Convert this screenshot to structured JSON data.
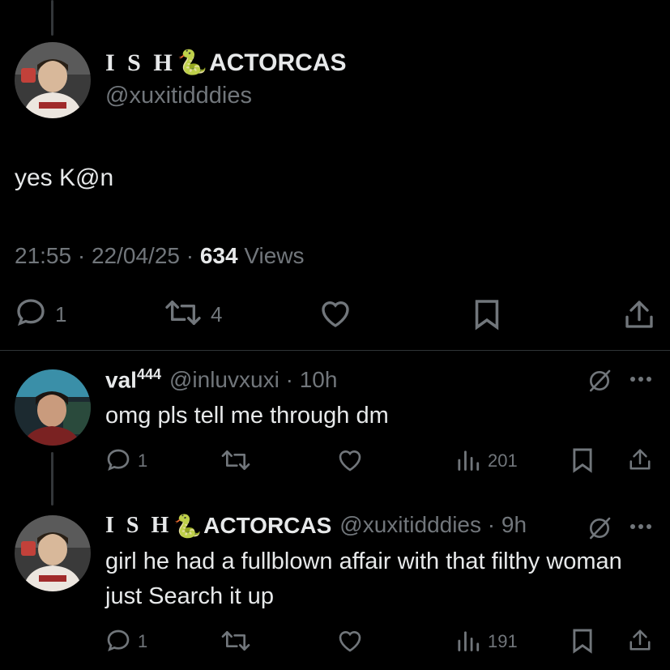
{
  "main_tweet": {
    "display_name_prefix": "I S H",
    "display_name_emoji": "🐍",
    "display_name_suffix": "ACTORCAS",
    "handle": "@xuxitidddies",
    "text": "yes K@n",
    "time": "21:55",
    "date": "22/04/25",
    "views_count": "634",
    "views_label": "Views",
    "reply_count": "1",
    "repost_count": "4"
  },
  "replies": [
    {
      "display_name": "val",
      "display_name_sup": "444",
      "handle": "@inluvxuxi",
      "age": "10h",
      "text": "omg pls tell me through dm",
      "reply_count": "1",
      "views_count": "201"
    },
    {
      "display_name_prefix": "I S H",
      "display_name_emoji": "🐍",
      "display_name_suffix": "ACTORCAS",
      "handle": "@xuxitidddies",
      "age": "9h",
      "text": "girl he had a fullblown affair with that filthy woman just Search it up",
      "reply_count": "1",
      "views_count": "191"
    }
  ],
  "sep": " · ",
  "colors": {
    "background": "#000000",
    "text_primary": "#e7e9ea",
    "text_secondary": "#71767b",
    "divider": "#2f3336"
  },
  "icons": [
    "reply-icon",
    "repost-icon",
    "like-icon",
    "bookmark-icon",
    "share-icon",
    "views-icon",
    "grok-icon",
    "more-icon"
  ]
}
